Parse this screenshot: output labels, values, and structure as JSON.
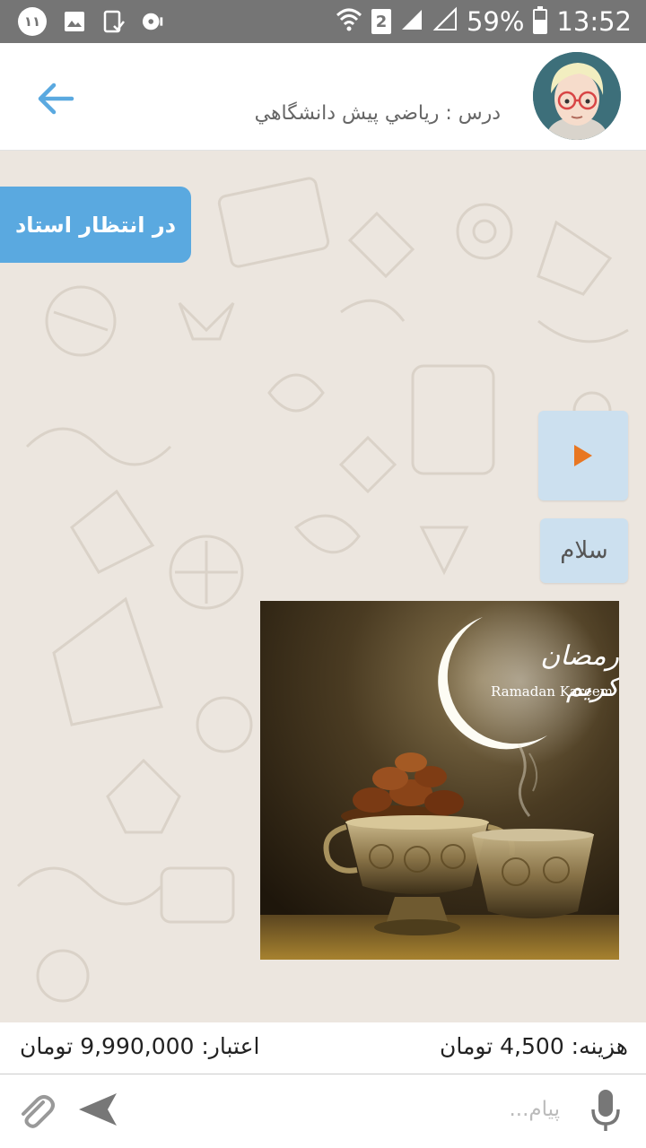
{
  "status_bar": {
    "notification_count": "۱۱",
    "sim_slot": "2",
    "battery_percent": "59%",
    "battery_level": 0.59,
    "time": "13:52",
    "icons": [
      "gallery-icon",
      "clipboard-check-icon",
      "media-icon",
      "wifi-icon",
      "signal-icon",
      "no-signal-icon",
      "battery-icon"
    ]
  },
  "header": {
    "course_title": "درس : رياضي پيش دانشگاهي",
    "back_icon": "arrow-left-icon",
    "colors": {
      "accent": "#5aa9e0"
    }
  },
  "chat": {
    "status_badge": "در انتظار استاد",
    "voice_message": {
      "icon": "play-icon",
      "play_color": "#e87722"
    },
    "text_message": "سلام",
    "image_message": {
      "caption_arabic": "رمضان كريم",
      "caption_english": "Ramadan Kareem"
    }
  },
  "info_bar": {
    "credit_text": "اعتبار: 9,990,000 تومان",
    "cost_text": "هزینه: 4,500 تومان"
  },
  "input_bar": {
    "placeholder": "پیام...",
    "icons": [
      "paperclip-icon",
      "send-icon",
      "microphone-icon"
    ]
  }
}
